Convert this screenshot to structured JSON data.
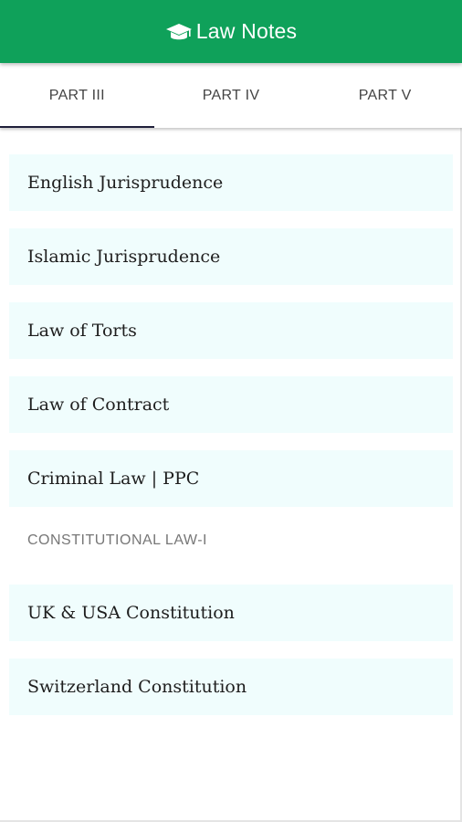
{
  "app_bar": {
    "title": "Law Notes",
    "icon": "graduation-cap-icon",
    "color": "#0fa15a"
  },
  "tabs": [
    {
      "label": "PART III",
      "active": true
    },
    {
      "label": "PART IV",
      "active": false
    },
    {
      "label": "PART V",
      "active": false
    }
  ],
  "list": {
    "items_group_1": [
      "English Jurisprudence",
      "Islamic Jurisprudence",
      "Law of Torts",
      "Law of Contract",
      "Criminal Law | PPC"
    ],
    "section_header": "CONSTITUTIONAL LAW-I",
    "items_group_2": [
      "UK & USA Constitution",
      "Switzerland Constitution"
    ],
    "card_background": "#f0fdfd"
  }
}
